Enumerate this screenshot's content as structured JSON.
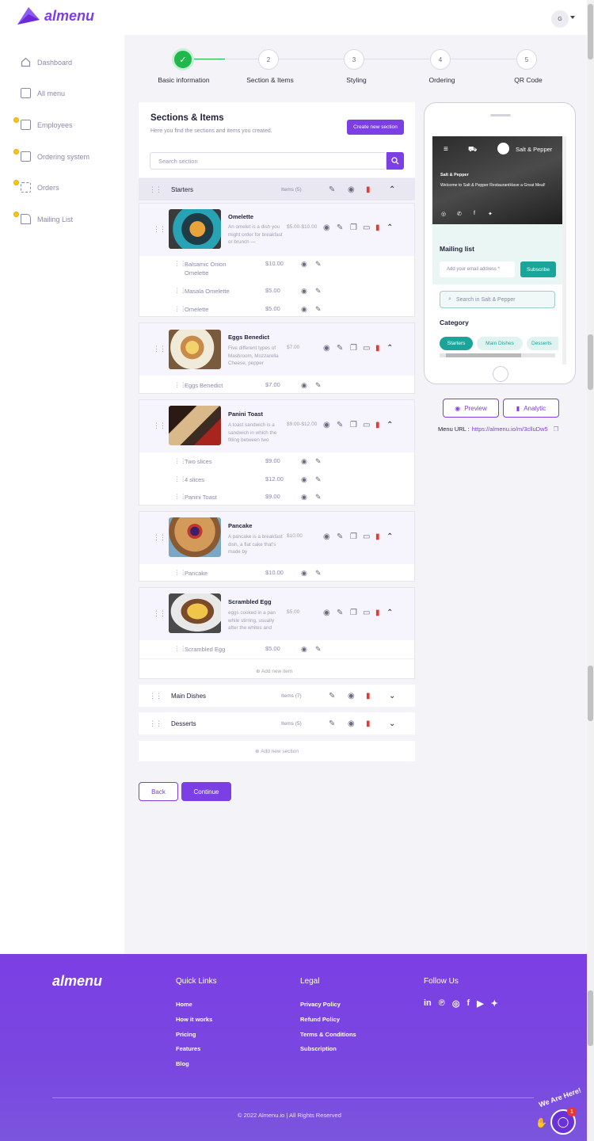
{
  "brand": {
    "name": "almenu"
  },
  "user": {
    "initial": "G"
  },
  "sidebar": {
    "items": [
      {
        "label": "Dashboard",
        "icon": "home-icon"
      },
      {
        "label": "All menu",
        "icon": "menu-icon"
      },
      {
        "label": "Employees",
        "icon": "employees-icon"
      },
      {
        "label": "Ordering system",
        "icon": "ordering-icon"
      },
      {
        "label": "Orders",
        "icon": "orders-icon"
      },
      {
        "label": "Mailing List",
        "icon": "mail-icon"
      }
    ]
  },
  "steps": [
    {
      "num": "✓",
      "label": "Basic information",
      "done": true
    },
    {
      "num": "2",
      "label": "Section & Items"
    },
    {
      "num": "3",
      "label": "Styling"
    },
    {
      "num": "4",
      "label": "Ordering"
    },
    {
      "num": "5",
      "label": "QR Code"
    }
  ],
  "panel": {
    "title": "Sections & Items",
    "subtitle": "Here you find the sections and items you created.",
    "create_button": "Create new section",
    "search_placeholder": "Search section",
    "add_item": "Add new item",
    "add_section": "Add new section"
  },
  "sections": [
    {
      "name": "Starters",
      "count": "Items (5)"
    },
    {
      "name": "Main Dishes",
      "count": "Items (7)"
    },
    {
      "name": "Desserts",
      "count": "Items (5)"
    }
  ],
  "items": [
    {
      "name": "Omelette",
      "desc": "An omelet is a dish you might order for breakfast or brunch —",
      "price": "$5.00-$10.00",
      "subs": [
        {
          "name": "Balsamic Onion Omelette",
          "price": "$10.00"
        },
        {
          "name": "Masala Omelette",
          "price": "$5.00"
        },
        {
          "name": "Omelette",
          "price": "$5.00"
        }
      ]
    },
    {
      "name": "Eggs Benedict",
      "desc": "Five different types of Mashroom, Mozzarella Cheese, pepper",
      "price": "$7.00",
      "subs": [
        {
          "name": "Eggs Benedict",
          "price": "$7.00"
        }
      ]
    },
    {
      "name": "Panini Toast",
      "desc": "A toast sandwich is a sandwich in which the filling between two",
      "price": "$9.00-$12.00",
      "subs": [
        {
          "name": "Two slices",
          "price": "$9.00"
        },
        {
          "name": "4 slices",
          "price": "$12.00"
        },
        {
          "name": "Panini Toast",
          "price": "$9.00"
        }
      ]
    },
    {
      "name": "Pancake",
      "desc": "A pancake is a breakfast dish, a flat cake that's made by",
      "price": "$10.00",
      "subs": [
        {
          "name": "Pancake",
          "price": "$10.00"
        }
      ]
    },
    {
      "name": "Scrambled Egg",
      "desc": "eggs cooked in a pan while stirring, usually after the whites and",
      "price": "$5.00",
      "subs": [
        {
          "name": "Scrambled Egg",
          "price": "$5.00"
        }
      ]
    }
  ],
  "nav": {
    "back": "Back",
    "continue": "Continue"
  },
  "preview": {
    "restaurant": "Salt & Pepper",
    "hero_title": "Salt & Pepper",
    "hero_text": "Welcome to Salt & Pepper RestaurantHave a Great Meal!",
    "mailing_title": "Mailing list",
    "email_placeholder": "Add your email address *",
    "subscribe": "Subscribe",
    "search_placeholder": "Search in Salt & Pepper",
    "category_title": "Category",
    "categories": [
      "Starters",
      "Main Dishes",
      "Desserts"
    ]
  },
  "actions": {
    "preview": "Preview",
    "analytic": "Analytic"
  },
  "menu_url": {
    "label": "Menu URL :",
    "value": "https://almenu.io/m/3clluDw5"
  },
  "footer": {
    "brand": "almenu",
    "quick_links_title": "Quick Links",
    "quick_links": [
      "Home",
      "How it works",
      "Pricing",
      "Features",
      "Blog"
    ],
    "legal_title": "Legal",
    "legal": [
      "Privacy Policy",
      "Refund Policy",
      "Terms & Conditions",
      "Subscription"
    ],
    "follow_title": "Follow Us",
    "social": [
      "linkedin-icon",
      "pinterest-icon",
      "instagram-icon",
      "facebook-icon",
      "youtube-icon",
      "twitter-icon"
    ],
    "copyright": "© 2022 Almenu.io | All Rights Reserved"
  },
  "chat": {
    "label": "We Are Here!",
    "badge": "1"
  },
  "colors": {
    "accent": "#7b3fe4",
    "success": "#1fb84a",
    "teal": "#1aa59a",
    "danger": "#e53935"
  }
}
